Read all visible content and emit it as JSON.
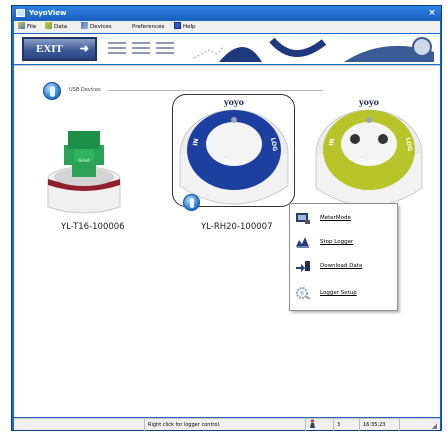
{
  "window": {
    "title": "YoyoView"
  },
  "menu": {
    "items": [
      {
        "label": "File"
      },
      {
        "label": "Data"
      },
      {
        "label": "Devices"
      },
      {
        "label": "Preferences"
      },
      {
        "label": "Help"
      }
    ]
  },
  "toolbar": {
    "exit_label": "EXIT"
  },
  "devices": {
    "group_label": "USB Devices",
    "items": [
      {
        "name": "YL-T16-100006",
        "knob_color": "#d4d4d4",
        "brand": "Grant"
      },
      {
        "name": "YL-RH20-100007",
        "knob_color": "#1d3fa0",
        "brand": "Grant",
        "side_left": "IN",
        "side_right": "LOG",
        "top": "yoyo"
      },
      {
        "name": "",
        "knob_color": "#b7c52b",
        "brand": "Grant",
        "side_left": "IN",
        "side_right": "LOG",
        "top": "yoyo"
      }
    ]
  },
  "context_menu": {
    "items": [
      {
        "label": "MeterMode",
        "icon": "meter-icon"
      },
      {
        "label": "Stop Logger",
        "icon": "stop-logger-icon"
      },
      {
        "label": "Download Data",
        "icon": "download-icon"
      },
      {
        "label": "Logger Setup",
        "icon": "setup-icon"
      }
    ]
  },
  "status": {
    "hint": "Right click for logger control.",
    "count": "3",
    "time": "16:35:23"
  }
}
